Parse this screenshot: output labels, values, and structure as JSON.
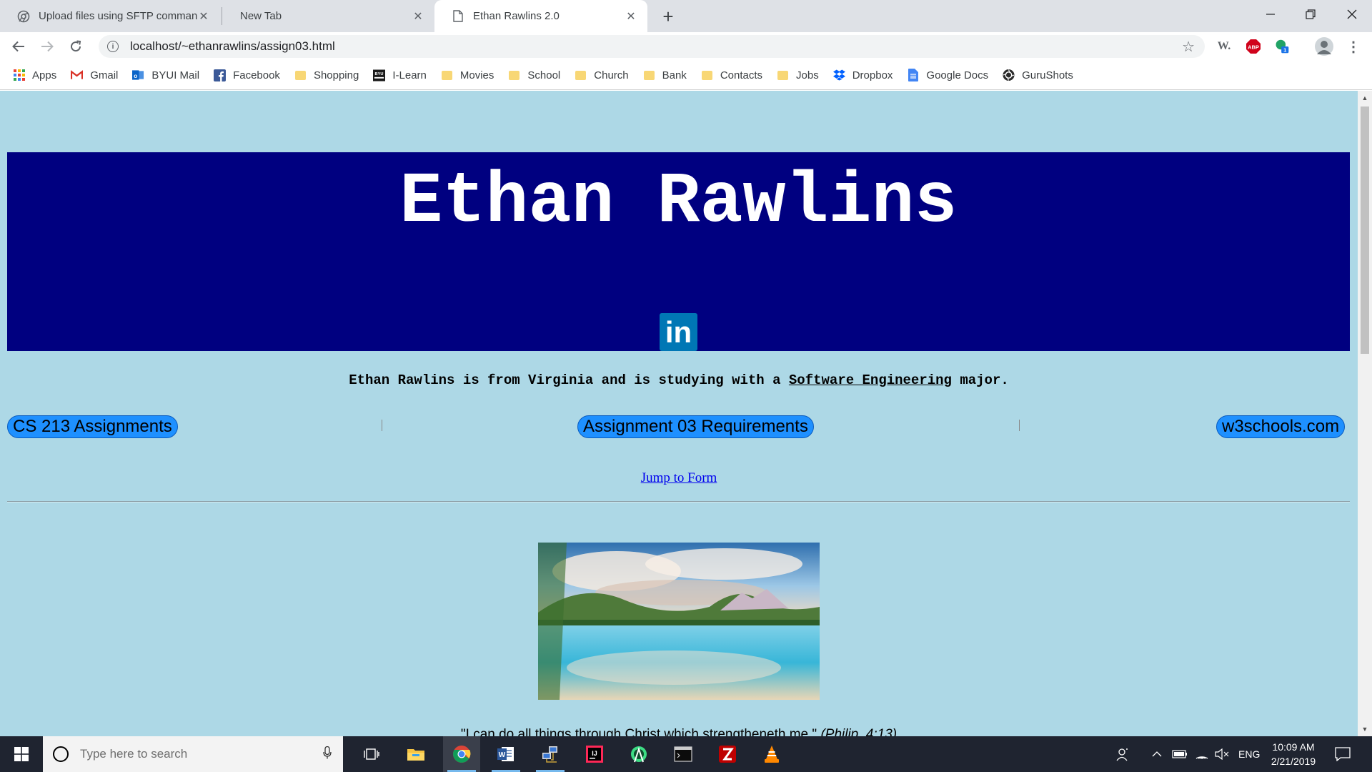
{
  "browser": {
    "tabs": [
      {
        "title": "Upload files using SFTP comman",
        "favicon": "chrome-icon"
      },
      {
        "title": "New Tab",
        "favicon": ""
      },
      {
        "title": "Ethan Rawlins 2.0",
        "favicon": "page-icon",
        "active": true
      }
    ],
    "url": "localhost/~ethanrawlins/assign03.html",
    "extensions": {
      "w_label": "W.",
      "abp_label": "ABP",
      "badge_count": "1"
    },
    "bookmarks": [
      {
        "label": "Apps",
        "icon": "apps-icon"
      },
      {
        "label": "Gmail",
        "icon": "gmail-icon"
      },
      {
        "label": "BYUI Mail",
        "icon": "outlook-icon"
      },
      {
        "label": "Facebook",
        "icon": "facebook-icon"
      },
      {
        "label": "Shopping",
        "icon": "folder-icon"
      },
      {
        "label": "I-Learn",
        "icon": "byui-icon"
      },
      {
        "label": "Movies",
        "icon": "folder-icon"
      },
      {
        "label": "School",
        "icon": "folder-icon"
      },
      {
        "label": "Church",
        "icon": "folder-icon"
      },
      {
        "label": "Bank",
        "icon": "folder-icon"
      },
      {
        "label": "Contacts",
        "icon": "folder-icon"
      },
      {
        "label": "Jobs",
        "icon": "folder-icon"
      },
      {
        "label": "Dropbox",
        "icon": "dropbox-icon"
      },
      {
        "label": "Google Docs",
        "icon": "docs-icon"
      },
      {
        "label": "GuruShots",
        "icon": "gurushots-icon"
      }
    ]
  },
  "page": {
    "title": "Ethan Rawlins",
    "linkedin_label": "in",
    "intro_prefix": "Ethan Rawlins is from Virginia and is studying with a ",
    "intro_link": "Software Engineering",
    "intro_suffix": " major.",
    "nav": [
      {
        "label": "CS 213 Assignments"
      },
      {
        "label": "Assignment 03 Requirements"
      },
      {
        "label": "w3schools.com"
      }
    ],
    "jump_link": "Jump to Form",
    "quote_text": "\"I can do all things through Christ which strengtheneth me.\" ",
    "quote_ref": "(Philip. 4:13)",
    "colors": {
      "background": "#add8e6",
      "banner": "#000080",
      "pill": "#1e90ff"
    }
  },
  "taskbar": {
    "search_placeholder": "Type here to search",
    "language": "ENG",
    "time": "10:09 AM",
    "date": "2/21/2019",
    "apps": [
      "task-view-icon",
      "file-explorer-icon",
      "chrome-icon",
      "word-icon",
      "network-app-icon",
      "intellij-icon",
      "android-studio-icon",
      "terminal-icon",
      "filezilla-icon",
      "vlc-icon"
    ]
  }
}
